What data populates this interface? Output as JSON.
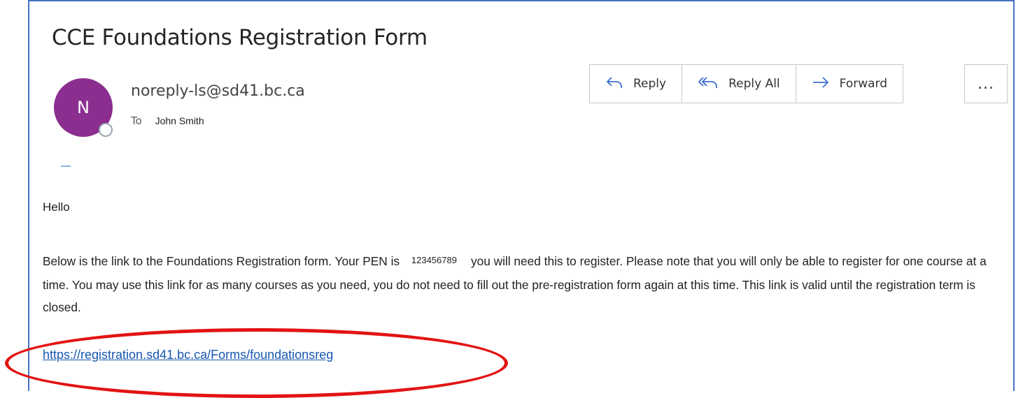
{
  "email": {
    "subject": "CCE Foundations Registration Form",
    "avatar_initial": "N",
    "sender": "noreply-ls@sd41.bc.ca",
    "to_label": "To",
    "to_name": "John Smith"
  },
  "actions": {
    "reply": {
      "label": "Reply",
      "icon": "reply-icon"
    },
    "reply_all": {
      "label": "Reply All",
      "icon": "reply-all-icon"
    },
    "forward": {
      "label": "Forward",
      "icon": "forward-icon"
    },
    "more": {
      "label": "...",
      "icon": "more-icon"
    }
  },
  "body": {
    "greeting": "Hello",
    "para_part1": "Below is the link to the Foundations Registration form. Your PEN is",
    "pen": "123456789",
    "para_part2": "you will need this to register. Please note that you will only be able to register for one course at a time. You may use this link for as many courses as you need, you do not need to fill out the pre-registration form again at this time. This link is valid until the registration term is closed.",
    "link": "https://registration.sd41.bc.ca/Forms/foundationsreg"
  },
  "colors": {
    "avatar": "#8b2e8f",
    "accent": "#3d6fd1",
    "highlight": "#e31313",
    "link": "#1557b0"
  }
}
